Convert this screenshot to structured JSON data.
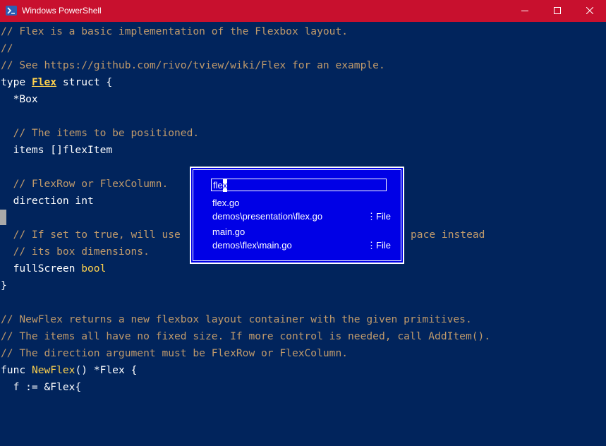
{
  "window": {
    "title": "Windows PowerShell",
    "icon": "powershell-icon",
    "controls": [
      "minimize-icon",
      "maximize-icon",
      "close-icon"
    ]
  },
  "colors": {
    "titlebar": "#c8102e",
    "editor_background": "#01245c",
    "comment": "#c09a6b",
    "highlight": "#ffd24d",
    "dialog_background": "#0000e6"
  },
  "code": {
    "l1": "// Flex is a basic implementation of the Flexbox layout.",
    "l2": "//",
    "l3": "// See https://github.com/rivo/tview/wiki/Flex for an example.",
    "l4_kw": "type",
    "l4_name": "Flex",
    "l4_rest": "struct {",
    "l5": "  *Box",
    "l7": "  // The items to be positioned.",
    "l8": "  items []flexItem",
    "l10": "  // FlexRow or FlexColumn.",
    "l11": "  direction int",
    "l13a": "  // If set to true, will use",
    "l13b": "pace instead",
    "l14": "  // its box dimensions.",
    "l15a": "  fullScreen",
    "l15b": "bool",
    "l16": "}",
    "l18": "// NewFlex returns a new flexbox layout container with the given primitives.",
    "l19": "// The items all have no fixed size. If more control is needed, call AddItem().",
    "l20": "// The direction argument must be FlexRow or FlexColumn.",
    "l21a": "func",
    "l21b": "NewFlex",
    "l21c": "() *Flex {",
    "l22": "  f := &Flex{"
  },
  "search": {
    "typed": "fle",
    "caret_char": "x"
  },
  "results": [
    {
      "name": "flex.go",
      "path": "demos\\presentation\\flex.go",
      "type": "File"
    },
    {
      "name": "main.go",
      "path": "demos\\flex\\main.go",
      "type": "File"
    }
  ]
}
